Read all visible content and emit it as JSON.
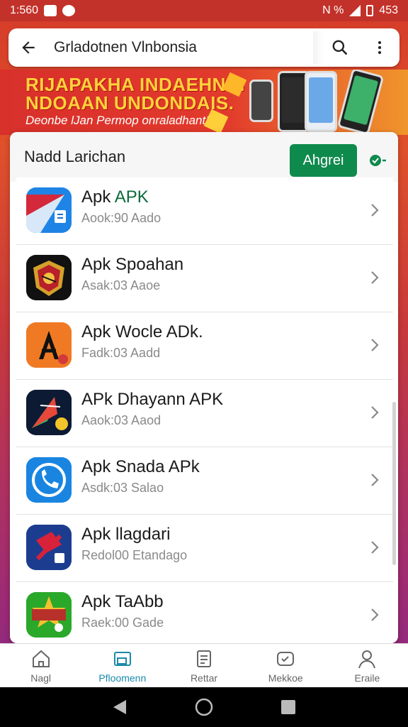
{
  "status_bar": {
    "time": "1:560",
    "right_text": "N %",
    "battery_text": "453"
  },
  "topbar": {
    "title": "Grladotnen Vlnbonsia"
  },
  "banner": {
    "line1": "RIJAPAKHA INDAEHNNI",
    "line2": "NDOAAN UNDONDAIS.",
    "line3": "Deonbe lJan Permop onraladhant!"
  },
  "card": {
    "title": "Nadd Larichan",
    "agree_label": "Ahgrei"
  },
  "apps": [
    {
      "name_plain": "Apk ",
      "name_accent": "APK",
      "sub": "Aook:90 Aado",
      "icon_color": "#1a6fd0"
    },
    {
      "name_plain": "Apk Spoahan",
      "name_accent": "",
      "sub": "Asak:03 Aaoe",
      "icon_color": "#111111"
    },
    {
      "name_plain": "Apk Wocle ADk.",
      "name_accent": "",
      "sub": "Fadk:03 Aadd",
      "icon_color": "#f07a24"
    },
    {
      "name_plain": "APk Dhayann APK",
      "name_accent": "",
      "sub": "Aaok:03 Aaod",
      "icon_color": "#0d1a33"
    },
    {
      "name_plain": "Apk Snada APk",
      "name_accent": "",
      "sub": "Asdk:03 Salao",
      "icon_color": "#1a85e0"
    },
    {
      "name_plain": "Apk llagdari",
      "name_accent": "",
      "sub": "Redol00 Etandago",
      "icon_color": "#1c3d8f"
    },
    {
      "name_plain": "Apk TaAbb",
      "name_accent": "",
      "sub": "Raek:00 Gade",
      "icon_color": "#2aa82a"
    }
  ],
  "bottom_nav": [
    {
      "label": "Nagl",
      "icon": "home-icon",
      "active": false
    },
    {
      "label": "Pfloomenn",
      "icon": "apps-icon",
      "active": true
    },
    {
      "label": "Rettar",
      "icon": "list-icon",
      "active": false
    },
    {
      "label": "Mekkoe",
      "icon": "message-icon",
      "active": false
    },
    {
      "label": "Eraile",
      "icon": "profile-icon",
      "active": false
    }
  ],
  "colors": {
    "accent_green": "#0e8a4d",
    "nav_active": "#1a8aa8",
    "banner_yellow": "#ffd23a"
  }
}
